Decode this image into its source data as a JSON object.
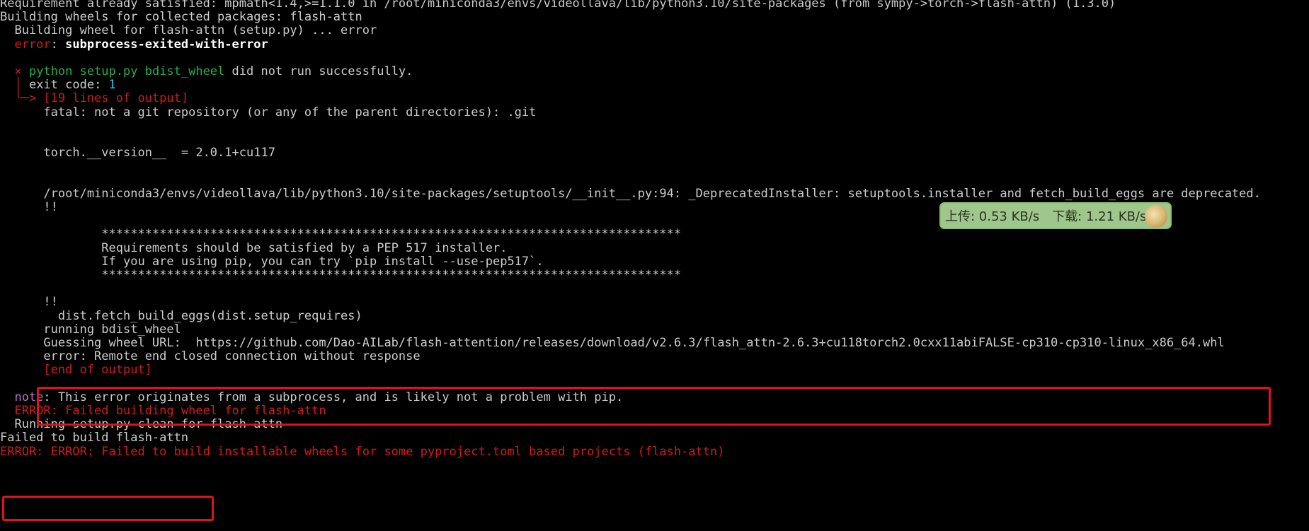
{
  "terminal": {
    "lines": [
      {
        "text": "Requirement already satisfied: mpmath<1.4,>=1.1.0 in /root/miniconda3/envs/videollava/lib/python3.10/site-packages (from sympy->torch->flash-attn) (1.3.0)",
        "color": "white"
      },
      {
        "text": "Building wheels for collected packages: flash-attn",
        "color": "white"
      },
      {
        "text": "  Building wheel for flash-attn (setup.py) ... error",
        "color": "white"
      },
      {
        "segments": [
          {
            "text": "  error",
            "color": "red"
          },
          {
            "text": ": ",
            "color": "white"
          },
          {
            "text": "subprocess-exited-with-error",
            "color": "bright"
          }
        ]
      },
      {
        "text": "",
        "color": "white"
      },
      {
        "segments": [
          {
            "text": "  × ",
            "color": "red"
          },
          {
            "text": "python setup.py bdist_wheel",
            "color": "green"
          },
          {
            "text": " did not run successfully.",
            "color": "white"
          }
        ]
      },
      {
        "segments": [
          {
            "text": "  │ ",
            "color": "red"
          },
          {
            "text": "exit code: ",
            "color": "white"
          },
          {
            "text": "1",
            "color": "cyan"
          }
        ]
      },
      {
        "text": "  ╰─> [19 lines of output]",
        "color": "red"
      },
      {
        "text": "      fatal: not a git repository (or any of the parent directories): .git",
        "color": "white"
      },
      {
        "text": "",
        "color": "white"
      },
      {
        "text": "",
        "color": "white"
      },
      {
        "text": "      torch.__version__  = 2.0.1+cu117",
        "color": "white"
      },
      {
        "text": "",
        "color": "white"
      },
      {
        "text": "",
        "color": "white"
      },
      {
        "text": "      /root/miniconda3/envs/videollava/lib/python3.10/site-packages/setuptools/__init__.py:94: _DeprecatedInstaller: setuptools.installer and fetch_build_eggs are deprecated.",
        "color": "white"
      },
      {
        "text": "      !!",
        "color": "white"
      },
      {
        "text": "",
        "color": "white"
      },
      {
        "text": "              ********************************************************************************",
        "color": "white"
      },
      {
        "text": "              Requirements should be satisfied by a PEP 517 installer.",
        "color": "white"
      },
      {
        "text": "              If you are using pip, you can try `pip install --use-pep517`.",
        "color": "white"
      },
      {
        "text": "              ********************************************************************************",
        "color": "white"
      },
      {
        "text": "",
        "color": "white"
      },
      {
        "text": "      !!",
        "color": "white"
      },
      {
        "text": "        dist.fetch_build_eggs(dist.setup_requires)",
        "color": "white"
      },
      {
        "text": "      running bdist_wheel",
        "color": "white"
      },
      {
        "text": "      Guessing wheel URL:  https://github.com/Dao-AILab/flash-attention/releases/download/v2.6.3/flash_attn-2.6.3+cu118torch2.0cxx11abiFALSE-cp310-cp310-linux_x86_64.whl",
        "color": "white"
      },
      {
        "text": "      error: Remote end closed connection without response",
        "color": "white"
      },
      {
        "text": "      [end of output]",
        "color": "red"
      },
      {
        "text": "",
        "color": "white"
      },
      {
        "segments": [
          {
            "text": "  note",
            "color": "magenta"
          },
          {
            "text": ": This error originates from a subprocess, and is likely not a problem with pip.",
            "color": "white"
          }
        ]
      },
      {
        "text": "  ERROR: Failed building wheel for flash-attn",
        "color": "red"
      },
      {
        "text": "  Running setup.py clean for flash-attn",
        "color": "white"
      },
      {
        "text": "Failed to build flash-attn",
        "color": "white"
      },
      {
        "text": "ERROR: ERROR: Failed to build installable wheels for some pyproject.toml based projects (flash-attn)",
        "color": "red"
      }
    ]
  },
  "overlay": {
    "upload_label": "上传: 0.53 KB/s",
    "download_label": "下载: 1.21 KB/s",
    "avatar_icon": "avatar-icon",
    "background": "#acd696"
  },
  "colors": {
    "background": "#000000",
    "text": "#cccccc",
    "error_red": "#d11a1a",
    "command_green": "#22b14c",
    "exit_code_cyan": "#3ac7e8",
    "note_magenta": "#b86fc7",
    "highlight_box": "#e0121f"
  }
}
